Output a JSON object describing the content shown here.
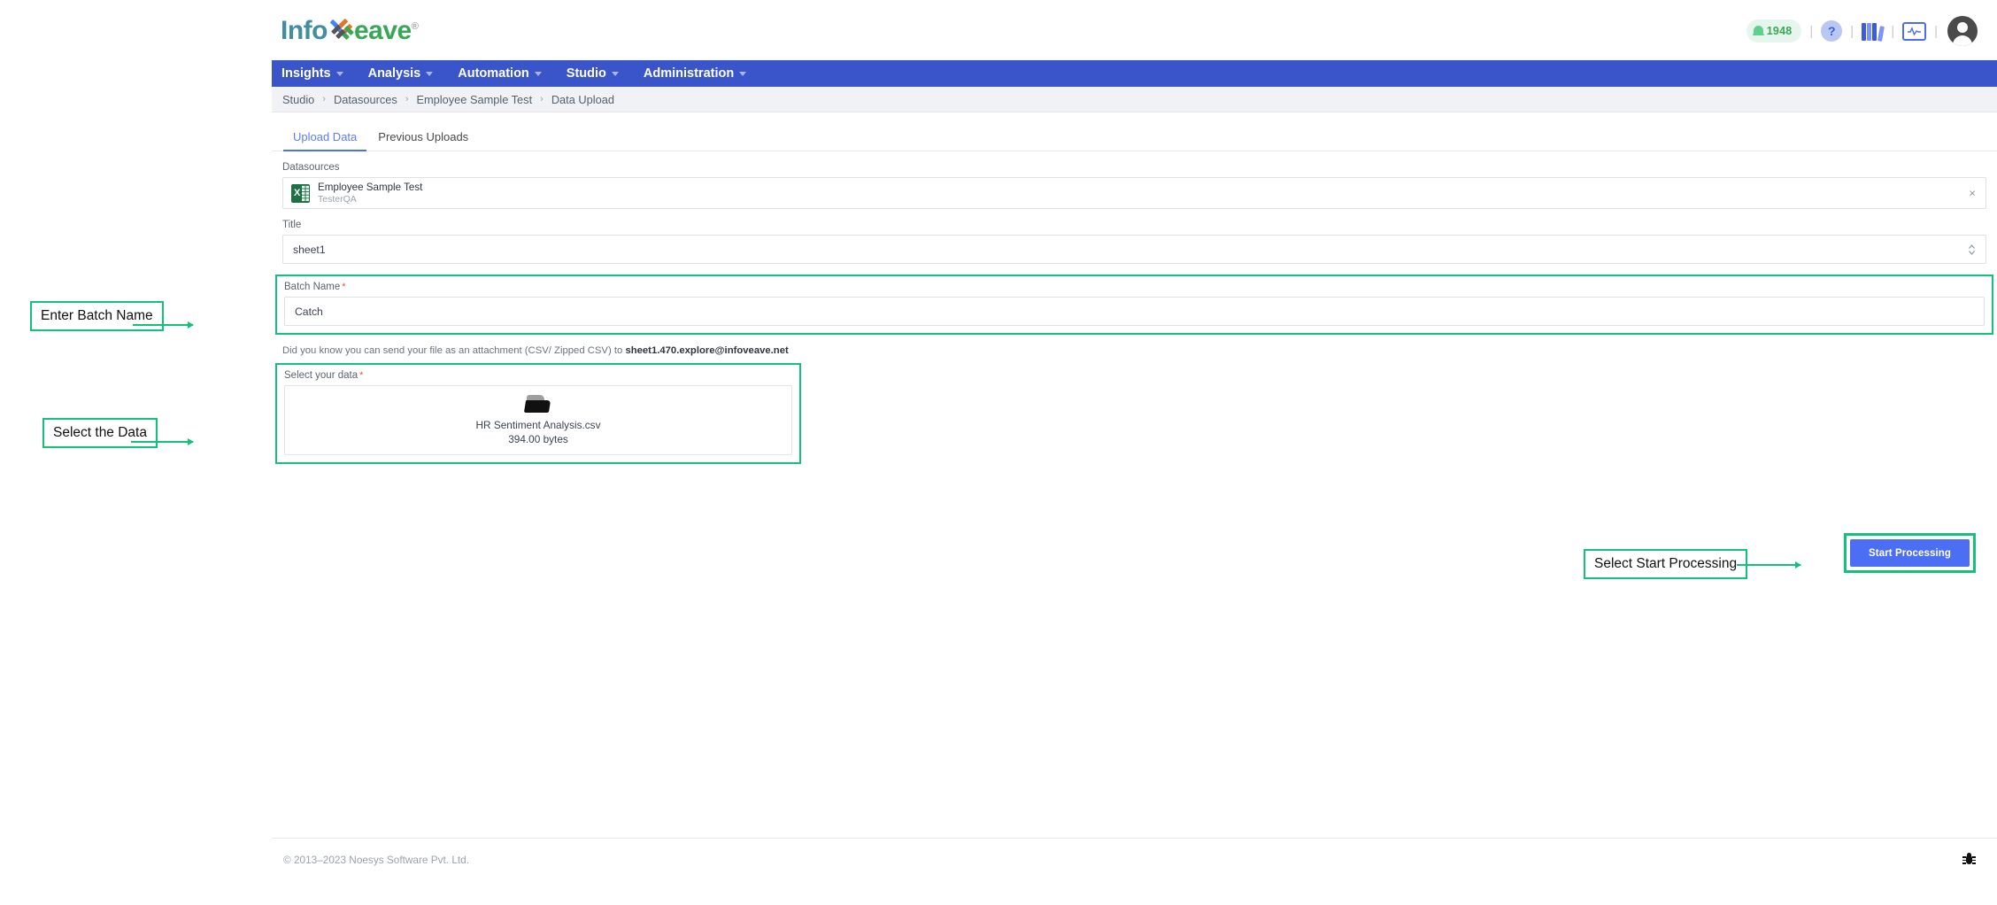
{
  "brand": {
    "name_part1": "Info",
    "name_part2": "eave",
    "registered": "®",
    "logo_icon": "infoveave-logo-icon"
  },
  "topbar": {
    "notification_count": "1948",
    "icons": {
      "bell": "bell-icon",
      "help": "?",
      "books": "library-icon",
      "monitor": "activity-monitor-icon",
      "avatar": "user-avatar-icon"
    },
    "separator": "|"
  },
  "nav": {
    "items": [
      {
        "label": "Insights"
      },
      {
        "label": "Analysis"
      },
      {
        "label": "Automation"
      },
      {
        "label": "Studio"
      },
      {
        "label": "Administration"
      }
    ]
  },
  "breadcrumb": {
    "items": [
      "Studio",
      "Datasources",
      "Employee Sample Test",
      "Data Upload"
    ],
    "separator": "›"
  },
  "tabs": [
    {
      "label": "Upload Data",
      "active": true
    },
    {
      "label": "Previous Uploads",
      "active": false
    }
  ],
  "form": {
    "datasources": {
      "label": "Datasources",
      "title": "Employee Sample Test",
      "subtitle": "TesterQA",
      "file_type_icon": "excel-icon",
      "close_icon": "×"
    },
    "title": {
      "label": "Title",
      "value": "sheet1"
    },
    "batch_name": {
      "label": "Batch Name",
      "required_marker": "*",
      "value": "Catch",
      "placeholder": "Batch Name"
    },
    "email_hint": {
      "prefix": "Did you know you can send your file as an attachment (CSV/ Zipped CSV) to ",
      "email": "sheet1.470.explore@infoveave.net"
    },
    "select_data": {
      "label": "Select your data",
      "required_marker": "*",
      "file_name": "HR Sentiment Analysis.csv",
      "file_size": "394.00 bytes",
      "folder_icon": "folder-icon"
    },
    "submit_button": "Start Processing"
  },
  "footer": {
    "copyright": "© 2013–2023 Noesys Software Pvt. Ltd.",
    "bug_icon": "bug-icon"
  },
  "annotations": [
    {
      "text": "Enter Batch Name"
    },
    {
      "text": "Select the Data"
    },
    {
      "text": "Select Start Processing"
    }
  ],
  "colors": {
    "nav_blue": "#3a54ca",
    "accent_blue": "#4c6ef5",
    "highlight_green": "#12c27a",
    "brand_teal": "#3f8fa0",
    "brand_green": "#3aa757"
  }
}
